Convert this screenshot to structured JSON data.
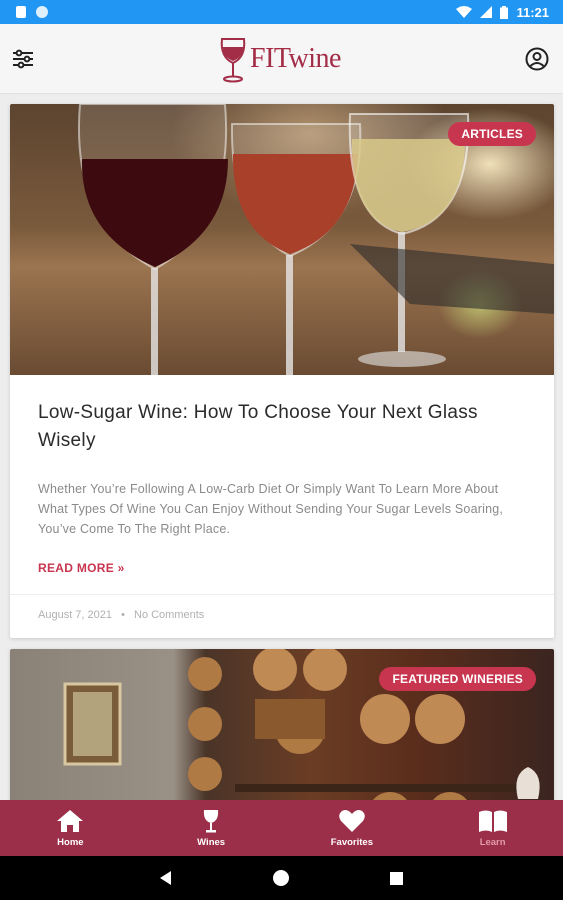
{
  "status_bar": {
    "time": "11:21"
  },
  "app": {
    "logo_text": "FITwine",
    "icons": {
      "filter": "sliders-icon",
      "account": "account-circle-icon"
    }
  },
  "posts": [
    {
      "badge": "ARTICLES",
      "title": "Low-Sugar Wine: How To Choose Your Next Glass Wisely",
      "excerpt": "Whether You’re Following A Low-Carb Diet Or Simply Want To Learn More About What Types Of Wine You Can Enjoy Without Sending Your Sugar Levels Soaring, You’ve Come To The Right Place.",
      "read_more": "READ MORE »",
      "date": "August 7, 2021",
      "separator": "•",
      "comments": "No Comments"
    },
    {
      "badge": "FEATURED WINERIES"
    }
  ],
  "bottom_nav": [
    {
      "label": "Home",
      "icon": "home-icon"
    },
    {
      "label": "Wines",
      "icon": "wine-glass-icon"
    },
    {
      "label": "Favorites",
      "icon": "heart-icon"
    },
    {
      "label": "Learn",
      "icon": "book-icon",
      "active": true
    }
  ],
  "colors": {
    "accent": "#c8354f",
    "nav_bg": "#9b2e48",
    "status_bar": "#2196f3"
  }
}
